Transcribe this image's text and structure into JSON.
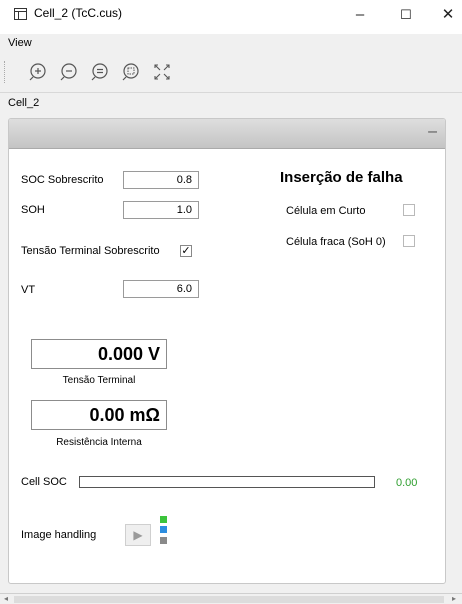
{
  "window": {
    "title": "Cell_2 (TcC.cus)",
    "minimize": "–",
    "maximize": "☐",
    "close": "✕"
  },
  "menu": {
    "view": "View"
  },
  "cell_tab": "Cell_2",
  "panel": {
    "minimize": "–",
    "soc_label": "SOC Sobrescrito",
    "soc_value": "0.8",
    "soh_label": "SOH",
    "soh_value": "1.0",
    "tension_override_label": "Tensão Terminal Sobrescrito",
    "tension_override_checked": "✓",
    "vt_label": "VT",
    "vt_value": "6.0",
    "fault_heading": "Inserção de falha",
    "short_label": "Célula em Curto",
    "weak_label": "Célula fraca (SoH 0)",
    "voltage_display": "0.000 V",
    "voltage_caption": "Tensão Terminal",
    "resistance_display": "0.00 mΩ",
    "resistance_caption": "Resistência Interna",
    "cell_soc_label": "Cell SOC",
    "cell_soc_value": "0.00",
    "cell_soc_fraction": 0,
    "image_handling_label": "Image handling",
    "play_glyph": "▶"
  },
  "colors": {
    "soc_green": "#2e9e2e",
    "square_green": "#3cc43c",
    "square_blue": "#2d8ee0",
    "square_gray": "#8a8a8a"
  }
}
